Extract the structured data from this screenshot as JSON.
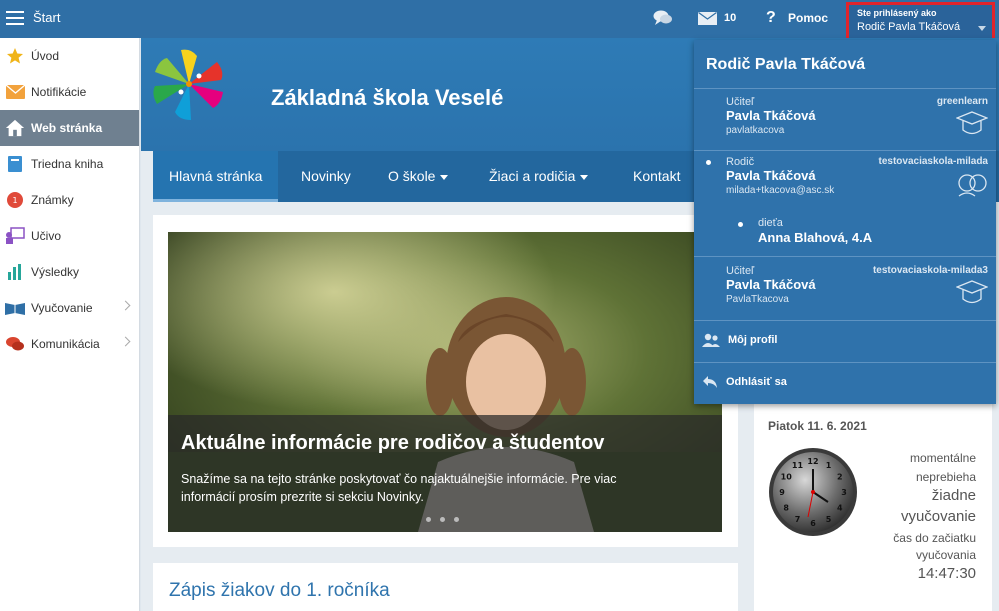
{
  "topbar": {
    "start_label": "Štart",
    "mail_count": "10",
    "help_label": "Pomoc",
    "user_box_label": "Ste prihlásený ako",
    "user_box_name": "Rodič Pavla Tkáčová"
  },
  "sidebar": {
    "items": [
      {
        "label": "Úvod",
        "icon": "star-icon"
      },
      {
        "label": "Notifikácie",
        "icon": "envelope-icon"
      },
      {
        "label": "Web stránka",
        "icon": "house-icon"
      },
      {
        "label": "Triedna kniha",
        "icon": "book-icon"
      },
      {
        "label": "Známky",
        "icon": "grades-icon"
      },
      {
        "label": "Učivo",
        "icon": "teacher-icon"
      },
      {
        "label": "Výsledky",
        "icon": "bar-chart-icon"
      },
      {
        "label": "Vyučovanie",
        "icon": "open-book-icon"
      },
      {
        "label": "Komunikácia",
        "icon": "chat-bubbles-icon"
      }
    ]
  },
  "banner": {
    "school_name": "Základná škola Veselé"
  },
  "nav": {
    "items": [
      "Hlavná stránka",
      "Novinky",
      "O škole",
      "Žiaci a rodičia",
      "Kontakt"
    ]
  },
  "slide": {
    "title": "Aktuálne informácie pre rodičov a študentov",
    "text": "Snažíme sa na tejto stránke poskytovať čo najaktuálnejšie informácie. Pre viac informácií prosím prezrite si sekciu Novinky."
  },
  "section2": {
    "title": "Zápis žiakov do 1. ročníka"
  },
  "widget": {
    "date": "Piatok 11. 6. 2021",
    "line1": "momentálne",
    "line2": "neprebieha",
    "line3": "žiadne",
    "line4": "vyučovanie",
    "line5": "čas do začiatku",
    "line6": "vyučovania",
    "time": "14:47:30"
  },
  "clock_numbers": [
    "12",
    "1",
    "2",
    "3",
    "4",
    "5",
    "6",
    "7",
    "8",
    "9",
    "10",
    "11"
  ],
  "dropdown": {
    "title": "Rodič Pavla Tkáčová",
    "accounts": [
      {
        "role": "Učiteľ",
        "school": "greenlearn",
        "name": "Pavla Tkáčová",
        "login": "pavlatkacova",
        "icon": "graduation-cap-icon"
      },
      {
        "role": "Rodič",
        "school": "testovaciaskola-milada",
        "name": "Pavla Tkáčová",
        "login": "milada+tkacova@asc.sk",
        "icon": "parents-icon"
      },
      {
        "role": "dieťa",
        "school": "",
        "name": "Anna Blahová, 4.A",
        "login": "",
        "icon": ""
      },
      {
        "role": "Učiteľ",
        "school": "testovaciaskola-milada3",
        "name": "Pavla Tkáčová",
        "login": "PavlaTkacova",
        "icon": "graduation-cap-icon"
      }
    ],
    "profile_label": "Môj profil",
    "logout_label": "Odhlásiť sa"
  }
}
